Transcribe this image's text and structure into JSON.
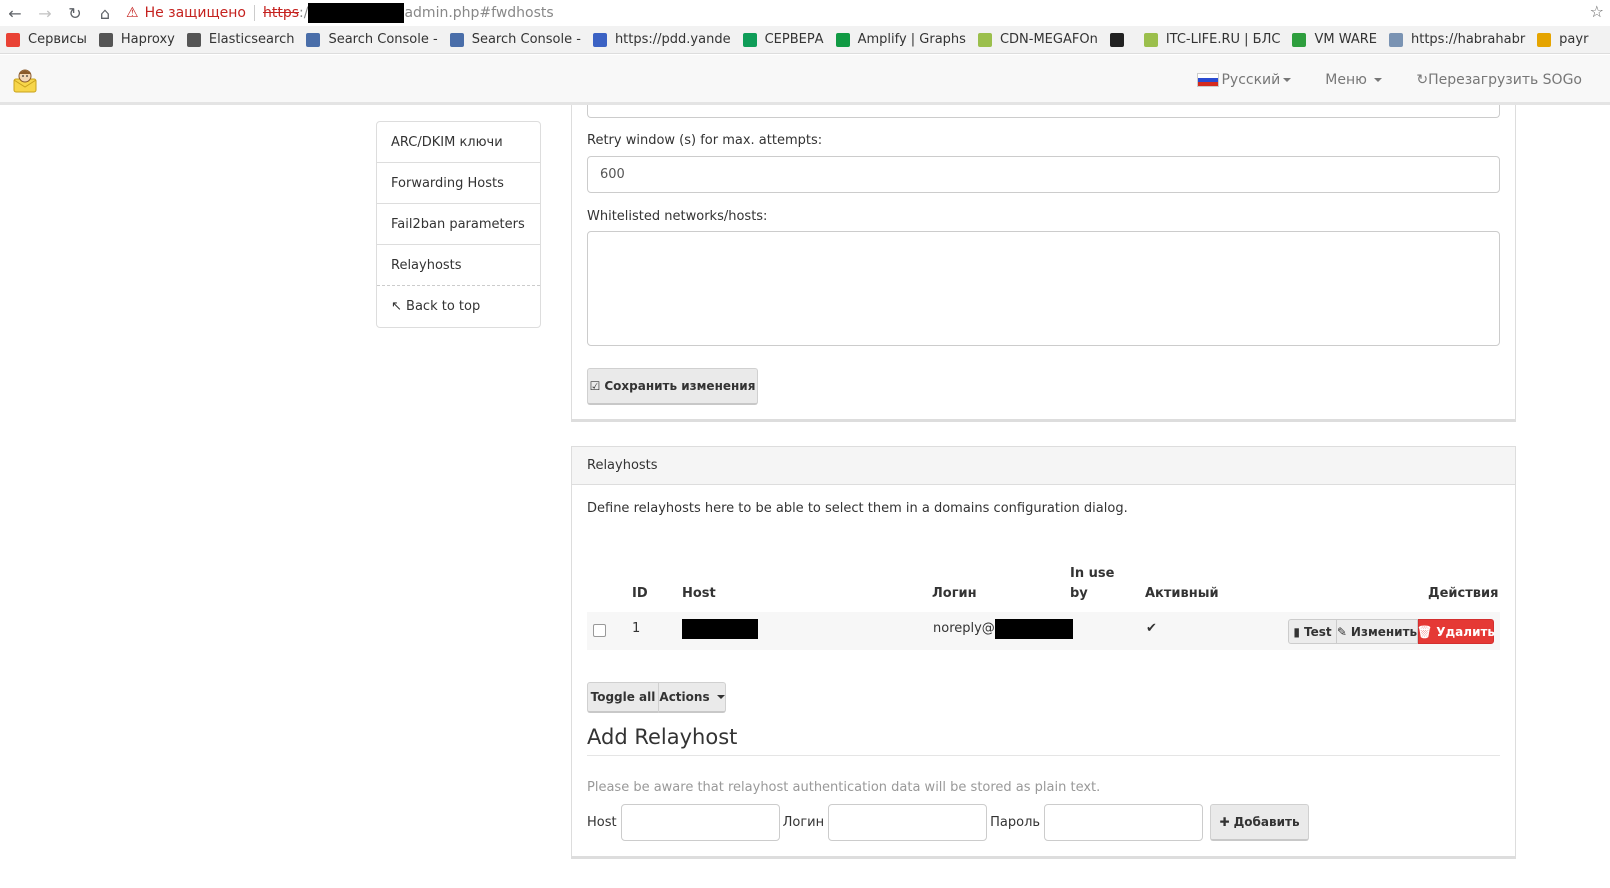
{
  "browser": {
    "insecure_label": "Не защищено",
    "url_protocol": "https",
    "url_rest": "admin.php#fwdhosts"
  },
  "bookmarks": [
    {
      "label": "Сервисы",
      "icon": "apps-icon",
      "color": "#e94235"
    },
    {
      "label": "Haproxy",
      "icon": "folder-icon",
      "color": "#555555"
    },
    {
      "label": "Elasticsearch",
      "icon": "folder-icon",
      "color": "#555555"
    },
    {
      "label": "Search Console -",
      "icon": "search-console-icon",
      "color": "#4a6ea9"
    },
    {
      "label": "Search Console -",
      "icon": "search-console-icon",
      "color": "#4a6ea9"
    },
    {
      "label": "https://pdd.yande",
      "icon": "mail-icon",
      "color": "#3b62c4"
    },
    {
      "label": "СЕРВЕРА",
      "icon": "sheets-icon",
      "color": "#0f9d58"
    },
    {
      "label": "Amplify | Graphs",
      "icon": "nginx-icon",
      "color": "#119a44"
    },
    {
      "label": "CDN-MEGAFOn",
      "icon": "cdn-icon",
      "color": "#9bbf4c"
    },
    {
      "label": "",
      "icon": "chart-icon",
      "color": "#222222"
    },
    {
      "label": "ITC-LIFE.RU | БЛС",
      "icon": "itc-icon",
      "color": "#9bbf4c"
    },
    {
      "label": "VM WARE",
      "icon": "vm-icon",
      "color": "#2e9e3e"
    },
    {
      "label": "https://habrahabr",
      "icon": "habr-icon",
      "color": "#7a93b3"
    },
    {
      "label": "payr",
      "icon": "payr-icon",
      "color": "#e5a400"
    }
  ],
  "navbar": {
    "language": "Русский",
    "menu": "Меню",
    "reload": "Перезагрузить SOGo"
  },
  "sidebar": {
    "items": [
      {
        "label": "ARC/DKIM ключи"
      },
      {
        "label": "Forwarding Hosts"
      },
      {
        "label": "Fail2ban parameters"
      },
      {
        "label": "Relayhosts"
      },
      {
        "label": "Back to top"
      }
    ]
  },
  "fail2ban": {
    "retry_label": "Retry window (s) for max. attempts:",
    "retry_value": "600",
    "whitelist_label": "Whitelisted networks/hosts:",
    "whitelist_value": "",
    "save_label": "Сохранить изменения"
  },
  "relayhosts": {
    "title": "Relayhosts",
    "description": "Define relayhosts here to be able to select them in a domains configuration dialog.",
    "columns": {
      "id": "ID",
      "host": "Host",
      "login": "Логин",
      "inuse_line1": "In use",
      "inuse_line2": "by",
      "active": "Активный",
      "actions": "Действия"
    },
    "rows": [
      {
        "id": "1",
        "login_prefix": "noreply@",
        "active": "✔"
      }
    ],
    "row_actions": {
      "test": "Test",
      "edit": "Изменить",
      "delete": "Удалить"
    },
    "toggle_all": "Toggle all",
    "actions_dropdown": "Actions"
  },
  "add_relayhost": {
    "title": "Add Relayhost",
    "note": "Please be aware that relayhost authentication data will be stored as plain text.",
    "host_label": "Host",
    "login_label": "Логин",
    "password_label": "Пароль",
    "add_button": "Добавить"
  }
}
